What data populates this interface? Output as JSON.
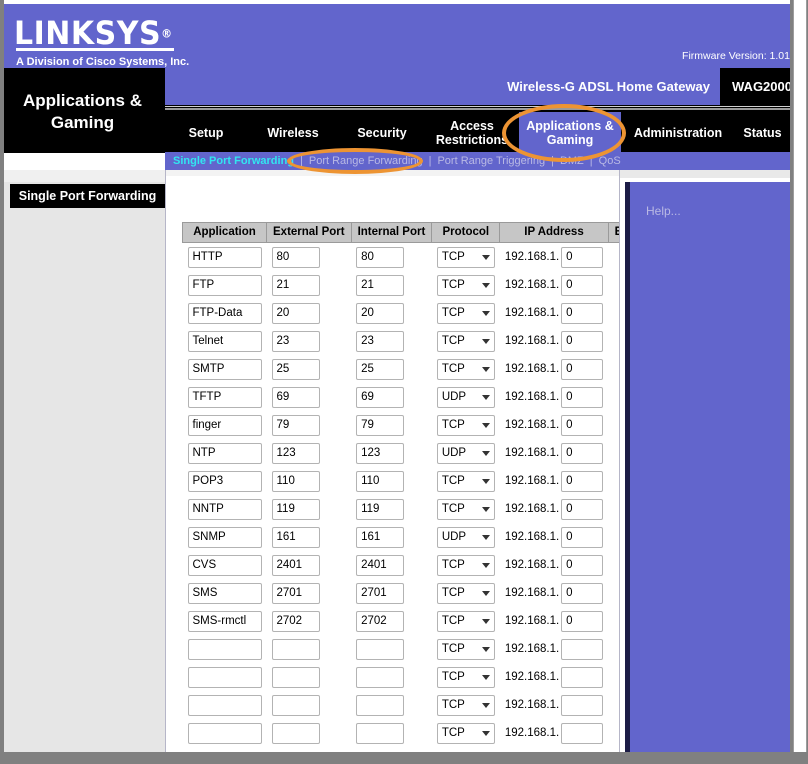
{
  "brand": {
    "name": "LINKSYS",
    "registered": "®",
    "tagline": "A Division of Cisco Systems, Inc.",
    "firmware": "Firmware Version: 1.01",
    "purple": "#6265CC",
    "annotation_color": "#ED9433"
  },
  "masthead": {
    "page_title": "Applications & Gaming",
    "product_name": "Wireless-G ADSL Home Gateway",
    "model": "WAG2000"
  },
  "tabs": [
    {
      "label": "Setup",
      "active": false
    },
    {
      "label": "Wireless",
      "active": false
    },
    {
      "label": "Security",
      "active": false
    },
    {
      "label": "Access Restrictions",
      "active": false
    },
    {
      "label": "Applications & Gaming",
      "active": true
    },
    {
      "label": "Administration",
      "active": false
    },
    {
      "label": "Status",
      "active": false
    }
  ],
  "subnav": {
    "items": [
      {
        "label": "Single Port Forwarding",
        "active": true
      },
      {
        "label": "Port Range Forwarding",
        "active": false
      },
      {
        "label": "Port Range Triggering",
        "active": false
      },
      {
        "label": "DMZ",
        "active": false
      },
      {
        "label": "QoS",
        "active": false
      }
    ],
    "separator": "|"
  },
  "sidebar": {
    "section_title": "Single Port Forwarding"
  },
  "help": {
    "label": "Help..."
  },
  "table": {
    "headers": {
      "application": "Application",
      "external_port": "External Port",
      "internal_port": "Internal Port",
      "protocol": "Protocol",
      "ip_address": "IP Address",
      "enabled": "Enabled"
    },
    "ip_prefix": "192.168.1.",
    "rows": [
      {
        "application": "HTTP",
        "external_port": "80",
        "internal_port": "80",
        "protocol": "TCP",
        "ip_suffix": "0",
        "enabled": false
      },
      {
        "application": "FTP",
        "external_port": "21",
        "internal_port": "21",
        "protocol": "TCP",
        "ip_suffix": "0",
        "enabled": false
      },
      {
        "application": "FTP-Data",
        "external_port": "20",
        "internal_port": "20",
        "protocol": "TCP",
        "ip_suffix": "0",
        "enabled": false
      },
      {
        "application": "Telnet",
        "external_port": "23",
        "internal_port": "23",
        "protocol": "TCP",
        "ip_suffix": "0",
        "enabled": false
      },
      {
        "application": "SMTP",
        "external_port": "25",
        "internal_port": "25",
        "protocol": "TCP",
        "ip_suffix": "0",
        "enabled": false
      },
      {
        "application": "TFTP",
        "external_port": "69",
        "internal_port": "69",
        "protocol": "UDP",
        "ip_suffix": "0",
        "enabled": false
      },
      {
        "application": "finger",
        "external_port": "79",
        "internal_port": "79",
        "protocol": "TCP",
        "ip_suffix": "0",
        "enabled": false
      },
      {
        "application": "NTP",
        "external_port": "123",
        "internal_port": "123",
        "protocol": "UDP",
        "ip_suffix": "0",
        "enabled": false
      },
      {
        "application": "POP3",
        "external_port": "110",
        "internal_port": "110",
        "protocol": "TCP",
        "ip_suffix": "0",
        "enabled": false
      },
      {
        "application": "NNTP",
        "external_port": "119",
        "internal_port": "119",
        "protocol": "TCP",
        "ip_suffix": "0",
        "enabled": false
      },
      {
        "application": "SNMP",
        "external_port": "161",
        "internal_port": "161",
        "protocol": "UDP",
        "ip_suffix": "0",
        "enabled": false
      },
      {
        "application": "CVS",
        "external_port": "2401",
        "internal_port": "2401",
        "protocol": "TCP",
        "ip_suffix": "0",
        "enabled": false
      },
      {
        "application": "SMS",
        "external_port": "2701",
        "internal_port": "2701",
        "protocol": "TCP",
        "ip_suffix": "0",
        "enabled": false
      },
      {
        "application": "SMS-rmctl",
        "external_port": "2702",
        "internal_port": "2702",
        "protocol": "TCP",
        "ip_suffix": "0",
        "enabled": false
      },
      {
        "application": "",
        "external_port": "",
        "internal_port": "",
        "protocol": "TCP",
        "ip_suffix": "",
        "enabled": false
      },
      {
        "application": "",
        "external_port": "",
        "internal_port": "",
        "protocol": "TCP",
        "ip_suffix": "",
        "enabled": false
      },
      {
        "application": "",
        "external_port": "",
        "internal_port": "",
        "protocol": "TCP",
        "ip_suffix": "",
        "enabled": false
      },
      {
        "application": "",
        "external_port": "",
        "internal_port": "",
        "protocol": "TCP",
        "ip_suffix": "",
        "enabled": false
      }
    ]
  }
}
